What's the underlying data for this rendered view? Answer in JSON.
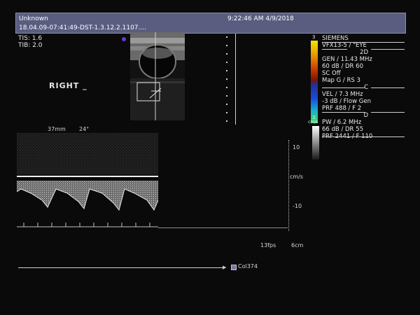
{
  "header": {
    "patient": "Unknown",
    "datetime": "9:22:46 AM 4/9/2018",
    "study_id": "18.04.09-07:41:49-DST-1.3.12.2.1107...."
  },
  "thermal": {
    "tis": "TIS: 1.6",
    "tib": "TIB: 2.0"
  },
  "annotation": {
    "side": "RIGHT _"
  },
  "geometry_labels": {
    "depth_mm": "37mm",
    "angle": "24°"
  },
  "colorbar": {
    "top_mark": "3",
    "mid_mark": "3",
    "unit": "cm/s",
    "gray_scale_top": "#ffffff",
    "colors": [
      "#f2e600",
      "#e89400",
      "#c83a00",
      "#7a1500",
      "#2c2a8a",
      "#1a4bd6",
      "#1ab0d0",
      "#3adc6a"
    ]
  },
  "settings": {
    "vendor": "SIEMENS",
    "probe": "VFX13-5 / \"EYE",
    "mode_2d_label": "2D",
    "mode_2d": [
      "GEN / 11.43 MHz",
      "60 dB / DR 60",
      "SC Off",
      "Map G / RS 3"
    ],
    "mode_c_label": "C",
    "mode_c": [
      "VEL / 7.3 MHz",
      "-3 dB / Flow Gen",
      "PRF 488 / F 2"
    ],
    "mode_d_label": "D",
    "mode_d": [
      "PW / 6.2 MHz",
      "66 dB / DR 55",
      "PRF 2441 / F 110"
    ]
  },
  "spectral_scale": {
    "upper": "10",
    "unit": "cm/s",
    "lower": "-10"
  },
  "footer": {
    "fps": "13fps",
    "depth": "6cm",
    "cine_label": "Col374"
  }
}
